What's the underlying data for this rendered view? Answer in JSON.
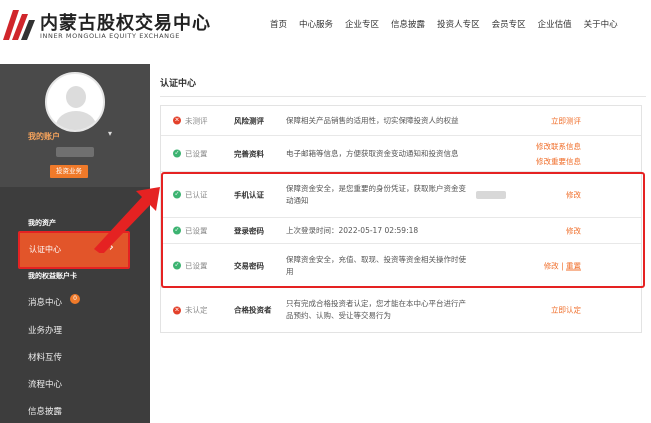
{
  "header": {
    "logo_cn": "内蒙古股权交易中心",
    "logo_en": "INNER MONGOLIA EQUITY EXCHANGE",
    "nav": [
      "首页",
      "中心服务",
      "企业专区",
      "信息披露",
      "投资人专区",
      "会员专区",
      "企业估值",
      "关于中心"
    ]
  },
  "sidebar": {
    "badge": "投资业务",
    "group_title": "我的账户",
    "sub_items": [
      "我的资产",
      "认证中心",
      "我的权益账户卡"
    ],
    "items": [
      "消息中心",
      "业务办理",
      "材料互传",
      "流程中心",
      "信息披露"
    ],
    "message_count": "0"
  },
  "main": {
    "title": "认证中心",
    "rows": [
      {
        "status": "未测评",
        "status_type": "red",
        "name": "风险测评",
        "desc": "保障相关产品销售的适用性，切实保障投资人的权益",
        "actions": [
          "立即测评"
        ]
      },
      {
        "status": "已设置",
        "status_type": "green",
        "name": "完善资料",
        "desc": "电子邮箱等信息，方便获取资金变动通知和投资信息",
        "actions": [
          "修改联系信息",
          "修改重要信息"
        ]
      },
      {
        "status": "已认证",
        "status_type": "green",
        "name": "手机认证",
        "desc": "保障资金安全，是您重要的身份凭证，获取账户资金变动通知",
        "actions": [
          "修改"
        ]
      },
      {
        "status": "已设置",
        "status_type": "green",
        "name": "登录密码",
        "desc": "上次登录时间：2022-05-17 02:59:18",
        "actions": [
          "修改"
        ]
      },
      {
        "status": "已设置",
        "status_type": "green",
        "name": "交易密码",
        "desc": "保障资金安全，充值、取现、投资等资金相关操作时使用",
        "actions": [
          "修改",
          "重置"
        ]
      },
      {
        "status": "未认定",
        "status_type": "red",
        "name": "合格投资者",
        "desc": "只有完成合格投资者认定，您才能在本中心平台进行产品预约、认购、受让等交易行为",
        "actions": [
          "立即认定"
        ]
      }
    ]
  },
  "colors": {
    "accent": "#e2552a",
    "highlight": "#e52222",
    "link": "#f06e2a",
    "sidebar": "#3d3d3d"
  }
}
